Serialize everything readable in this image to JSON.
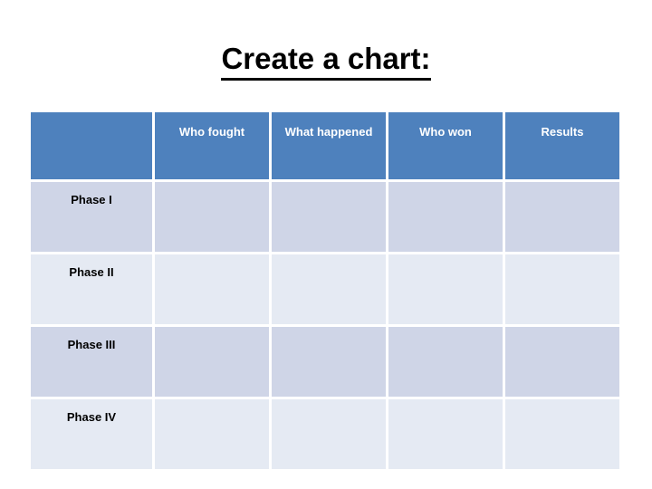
{
  "slide": {
    "title": "Create a chart:"
  },
  "table": {
    "columns": [
      {
        "key": "label",
        "header": ""
      },
      {
        "key": "who_fought",
        "header": "Who fought"
      },
      {
        "key": "what_happened",
        "header": "What happened"
      },
      {
        "key": "who_won",
        "header": "Who won"
      },
      {
        "key": "results",
        "header": "Results"
      }
    ],
    "rows": [
      {
        "label": "Phase I",
        "who_fought": "",
        "what_happened": "",
        "who_won": "",
        "results": ""
      },
      {
        "label": "Phase II",
        "who_fought": "",
        "what_happened": "",
        "who_won": "",
        "results": ""
      },
      {
        "label": "Phase III",
        "who_fought": "",
        "what_happened": "",
        "who_won": "",
        "results": ""
      },
      {
        "label": "Phase IV",
        "who_fought": "",
        "what_happened": "",
        "who_won": "",
        "results": ""
      }
    ]
  },
  "colors": {
    "header_fill": "#4E81BD",
    "header_text": "#FFFFFF",
    "row_band_dark": "#CFD5E7",
    "row_band_light": "#E5EAF3",
    "grid_gap": "#FFFFFF",
    "title_text": "#000000",
    "slide_background": "#FFFFFF"
  }
}
